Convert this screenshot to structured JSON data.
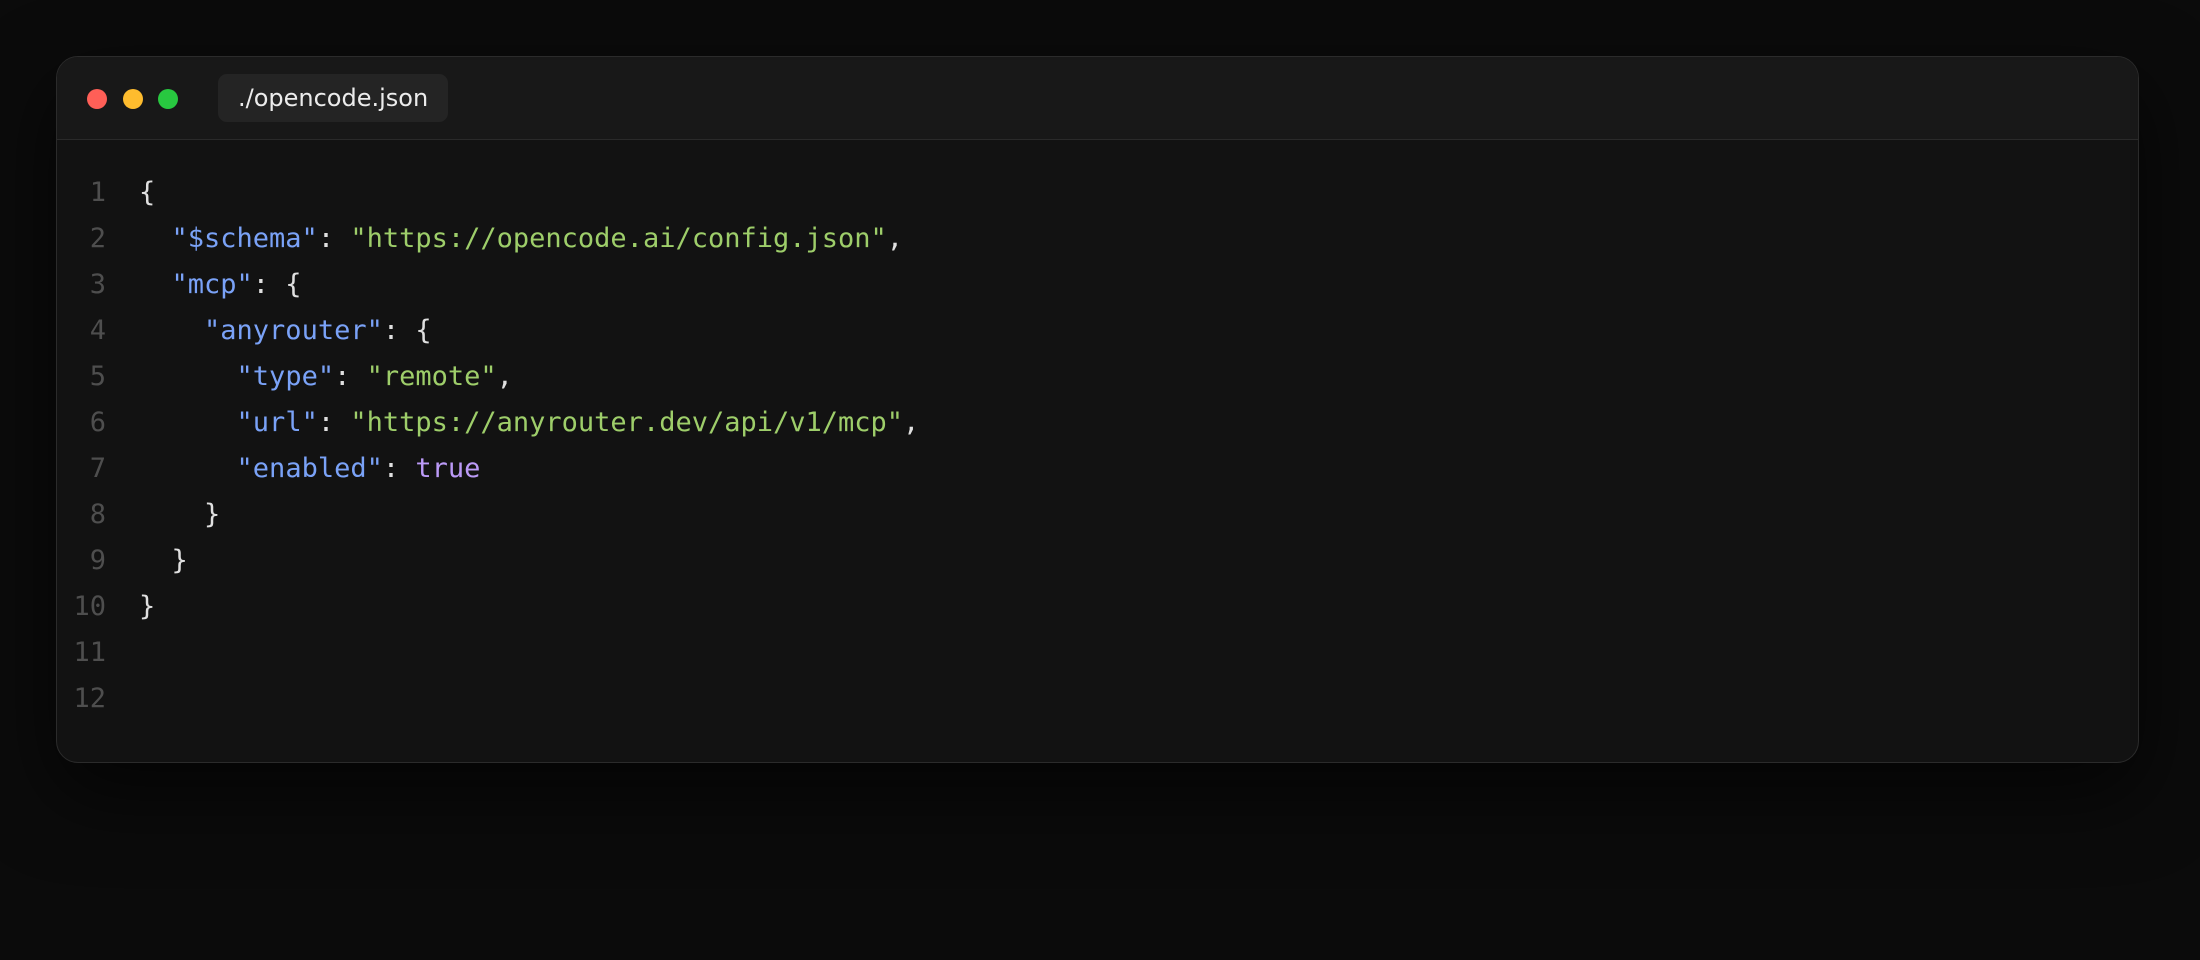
{
  "window": {
    "tab_title": "./opencode.json"
  },
  "editor": {
    "lines": [
      {
        "number": "1",
        "indent": "",
        "tokens": [
          {
            "t": "p",
            "v": "{"
          }
        ]
      },
      {
        "number": "2",
        "indent": "  ",
        "tokens": [
          {
            "t": "k",
            "v": "\"$schema\""
          },
          {
            "t": "p",
            "v": ": "
          },
          {
            "t": "s",
            "v": "\"https://opencode.ai/config.json\""
          },
          {
            "t": "p",
            "v": ","
          }
        ]
      },
      {
        "number": "3",
        "indent": "  ",
        "tokens": [
          {
            "t": "k",
            "v": "\"mcp\""
          },
          {
            "t": "p",
            "v": ": {"
          }
        ]
      },
      {
        "number": "4",
        "indent": "    ",
        "tokens": [
          {
            "t": "k",
            "v": "\"anyrouter\""
          },
          {
            "t": "p",
            "v": ": {"
          }
        ]
      },
      {
        "number": "5",
        "indent": "      ",
        "tokens": [
          {
            "t": "k",
            "v": "\"type\""
          },
          {
            "t": "p",
            "v": ": "
          },
          {
            "t": "s",
            "v": "\"remote\""
          },
          {
            "t": "p",
            "v": ","
          }
        ]
      },
      {
        "number": "6",
        "indent": "      ",
        "tokens": [
          {
            "t": "k",
            "v": "\"url\""
          },
          {
            "t": "p",
            "v": ": "
          },
          {
            "t": "s",
            "v": "\"https://anyrouter.dev/api/v1/mcp\""
          },
          {
            "t": "p",
            "v": ","
          }
        ]
      },
      {
        "number": "7",
        "indent": "      ",
        "tokens": [
          {
            "t": "k",
            "v": "\"enabled\""
          },
          {
            "t": "p",
            "v": ": "
          },
          {
            "t": "b",
            "v": "true"
          }
        ]
      },
      {
        "number": "8",
        "indent": "    ",
        "tokens": [
          {
            "t": "p",
            "v": "}"
          }
        ]
      },
      {
        "number": "9",
        "indent": "  ",
        "tokens": [
          {
            "t": "p",
            "v": "}"
          }
        ]
      },
      {
        "number": "10",
        "indent": "",
        "tokens": [
          {
            "t": "p",
            "v": "}"
          }
        ]
      },
      {
        "number": "11",
        "indent": "",
        "tokens": []
      },
      {
        "number": "12",
        "indent": "",
        "tokens": []
      }
    ]
  },
  "colors": {
    "key": "#7aa2f7",
    "string": "#9ece6a",
    "boolean": "#bb9af7",
    "punctuation": "#e0e0e0",
    "line_number": "#4e4e4e",
    "close_dot": "#ff5f57",
    "minimize_dot": "#febc2e",
    "maximize_dot": "#28c840"
  }
}
